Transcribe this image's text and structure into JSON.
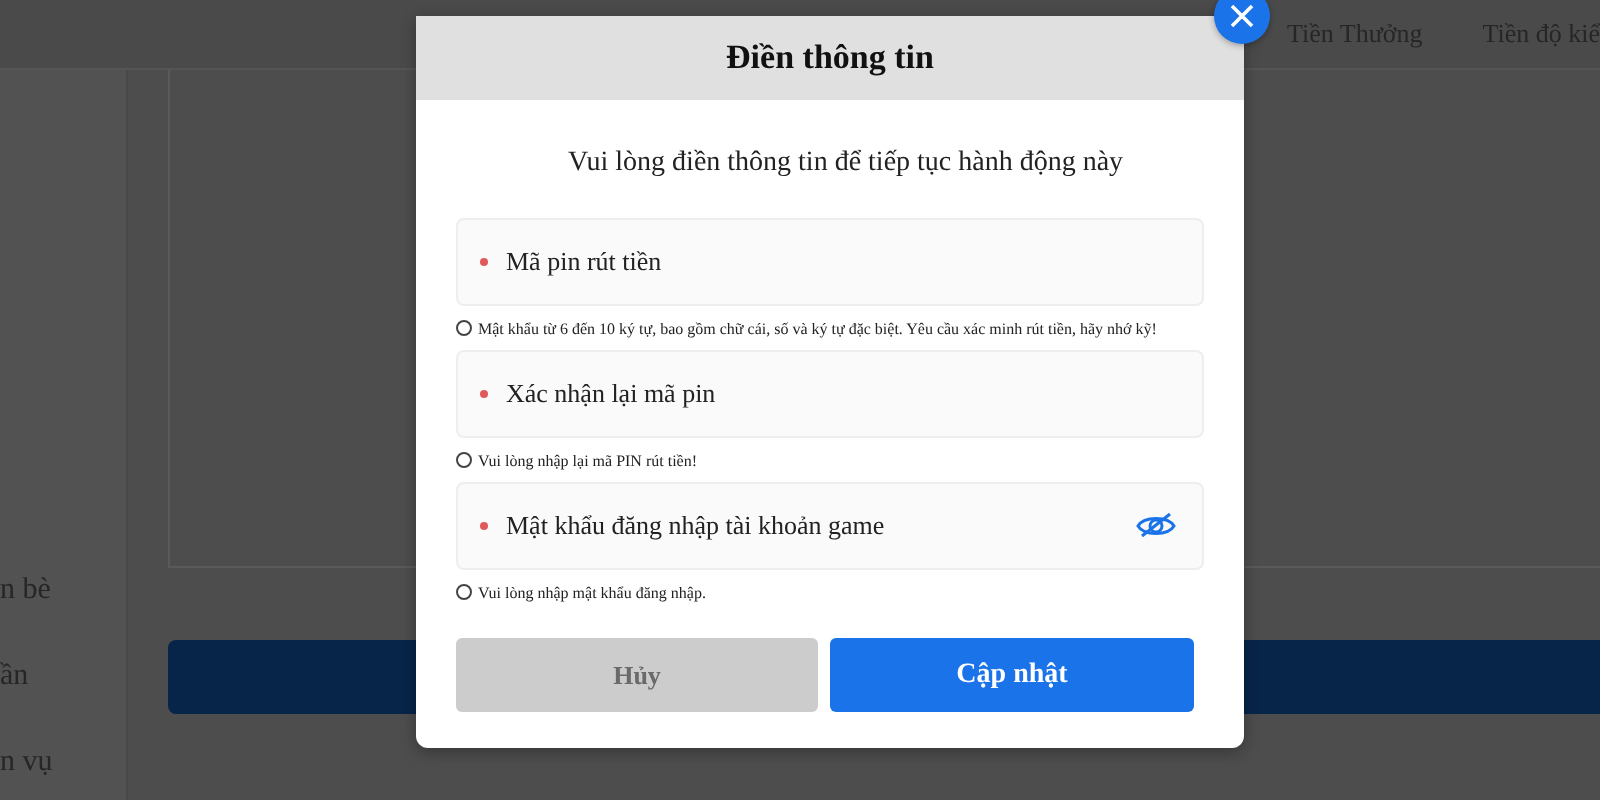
{
  "background": {
    "nav_links": [
      "Tiền Thưởng",
      "Tiền độ kiể"
    ],
    "sidebar_items": [
      "n bè",
      "ần",
      "n vụ"
    ]
  },
  "dialog": {
    "title": "Điền thông tin",
    "subtitle": "Vui lòng điền thông tin để tiếp tục hành động này",
    "fields": [
      {
        "kind": "text",
        "required": true,
        "placeholder": "Mã pin rút tiền",
        "hint": "Mật khẩu từ 6 đến 10 ký tự, bao gồm chữ cái, số và ký tự đặc biệt. Yêu cầu xác minh rút tiền, hãy nhớ kỹ!"
      },
      {
        "kind": "text",
        "required": true,
        "placeholder": "Xác nhận lại mã pin",
        "hint": "Vui lòng nhập lại mã PIN rút tiền!"
      },
      {
        "kind": "password",
        "required": true,
        "placeholder": "Mật khẩu đăng nhập tài khoản game",
        "hint": "Vui lòng nhập mật khẩu đăng nhập."
      }
    ],
    "buttons": [
      {
        "kind": "secondary",
        "label": "Hủy"
      },
      {
        "kind": "primary",
        "label": "Cập nhật"
      }
    ]
  }
}
